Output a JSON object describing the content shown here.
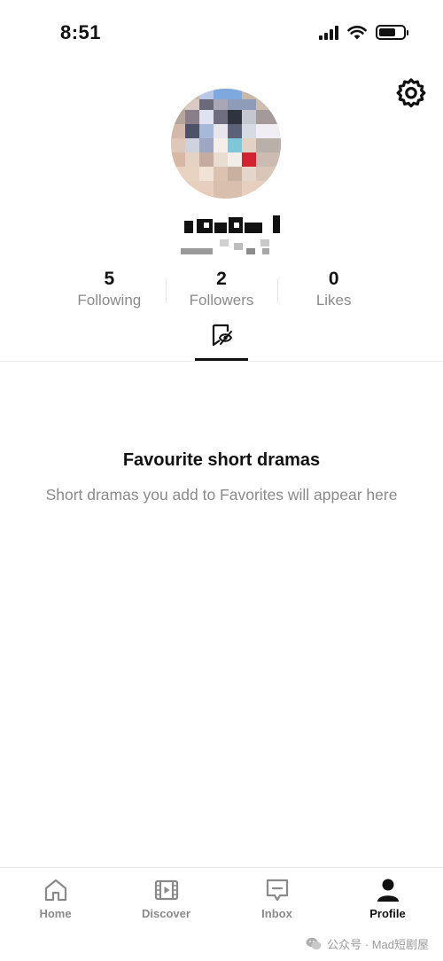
{
  "status_bar": {
    "time": "8:51"
  },
  "profile": {
    "stats": [
      {
        "value": "5",
        "label": "Following"
      },
      {
        "value": "2",
        "label": "Followers"
      },
      {
        "value": "0",
        "label": "Likes"
      }
    ],
    "active_tab_icon": "bookmark-icon"
  },
  "empty_state": {
    "title": "Favourite short dramas",
    "subtitle": "Short dramas you add to Favorites will appear here"
  },
  "bottom_nav": {
    "items": [
      {
        "label": "Home",
        "icon": "home-icon"
      },
      {
        "label": "Discover",
        "icon": "film-icon"
      },
      {
        "label": "Inbox",
        "icon": "message-icon"
      },
      {
        "label": "Profile",
        "icon": "person-icon",
        "active": true
      }
    ]
  },
  "watermark": {
    "text": "公众号 · Mad短剧屋"
  }
}
